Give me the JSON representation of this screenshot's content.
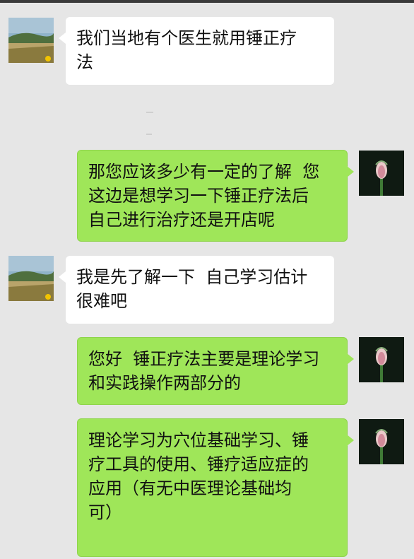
{
  "messages": [
    {
      "side": "left",
      "avatar": "landscape-avatar-icon",
      "text": "我们当地有个医生就用锤正疗\n法"
    },
    {
      "side": "right",
      "avatar": "flower-bud-avatar-icon",
      "text": "那您应该多少有一定的了解  您\n这边是想学习一下锤正疗法后\n自己进行治疗还是开店呢"
    },
    {
      "side": "left",
      "avatar": "landscape-avatar-icon",
      "text": "我是先了解一下  自己学习估计\n很难吧"
    },
    {
      "side": "right",
      "avatar": "flower-bud-avatar-icon",
      "text": "您好  锤正疗法主要是理论学习\n和实践操作两部分的"
    },
    {
      "side": "right",
      "avatar": "flower-bud-avatar-icon",
      "text": "理论学习为穴位基础学习、锤\n疗工具的使用、锤疗适应症的\n应用（有无中医理论基础均\n可）"
    }
  ],
  "colors": {
    "background": "#e6e6e6",
    "left_bubble": "#ffffff",
    "right_bubble": "#9fe659"
  }
}
